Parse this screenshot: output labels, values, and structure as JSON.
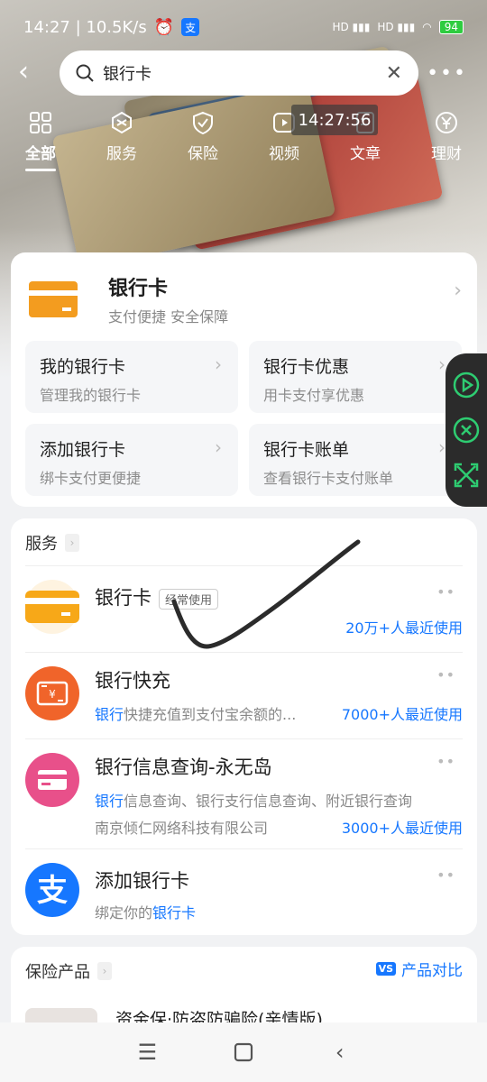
{
  "status_bar": {
    "time_speed": "14:27 | 10.5K/s",
    "battery": "94",
    "signal": "HD"
  },
  "search": {
    "value": "银行卡"
  },
  "tabs": [
    {
      "label": "全部",
      "icon": "grid-icon",
      "active": true
    },
    {
      "label": "服务",
      "icon": "box-icon"
    },
    {
      "label": "保险",
      "icon": "shield-icon"
    },
    {
      "label": "视频",
      "icon": "video-icon"
    },
    {
      "label": "文章",
      "icon": "article-icon"
    },
    {
      "label": "理财",
      "icon": "yuan-icon"
    }
  ],
  "time_overlay": "14:27:56",
  "main_card": {
    "title": "银行卡",
    "subtitle": "支付便捷 安全保障",
    "tiles": [
      {
        "title": "我的银行卡",
        "sub": "管理我的银行卡"
      },
      {
        "title": "银行卡优惠",
        "sub": "用卡支付享优惠"
      },
      {
        "title": "添加银行卡",
        "sub": "绑卡支付更便捷"
      },
      {
        "title": "银行卡账单",
        "sub": "查看银行卡支付账单"
      }
    ]
  },
  "services": {
    "header": "服务",
    "items": [
      {
        "title": "银行卡",
        "tag": "经常使用",
        "users": "20万+人最近使用"
      },
      {
        "title": "银行快充",
        "desc_hl": "银行",
        "desc": "快捷充值到支付宝余额的...",
        "users": "7000+人最近使用"
      },
      {
        "title": "银行信息查询-永无岛",
        "desc_hl": "银行",
        "desc": "信息查询、银行支行信息查询、附近银行查询",
        "desc2": "南京倾仁网络科技有限公司",
        "users": "3000+人最近使用"
      },
      {
        "title": "添加银行卡",
        "desc": "绑定你的",
        "desc_hl_after": "银行卡"
      }
    ]
  },
  "insurance": {
    "header": "保险产品",
    "compare": "产品对比",
    "vs": "VS",
    "first_title": "资金保·防盗防骗险(亲情版)"
  },
  "colors": {
    "accent": "#1677ff",
    "orange": "#f39c1f",
    "orange_red": "#f0642a",
    "pink": "#e8508a"
  }
}
